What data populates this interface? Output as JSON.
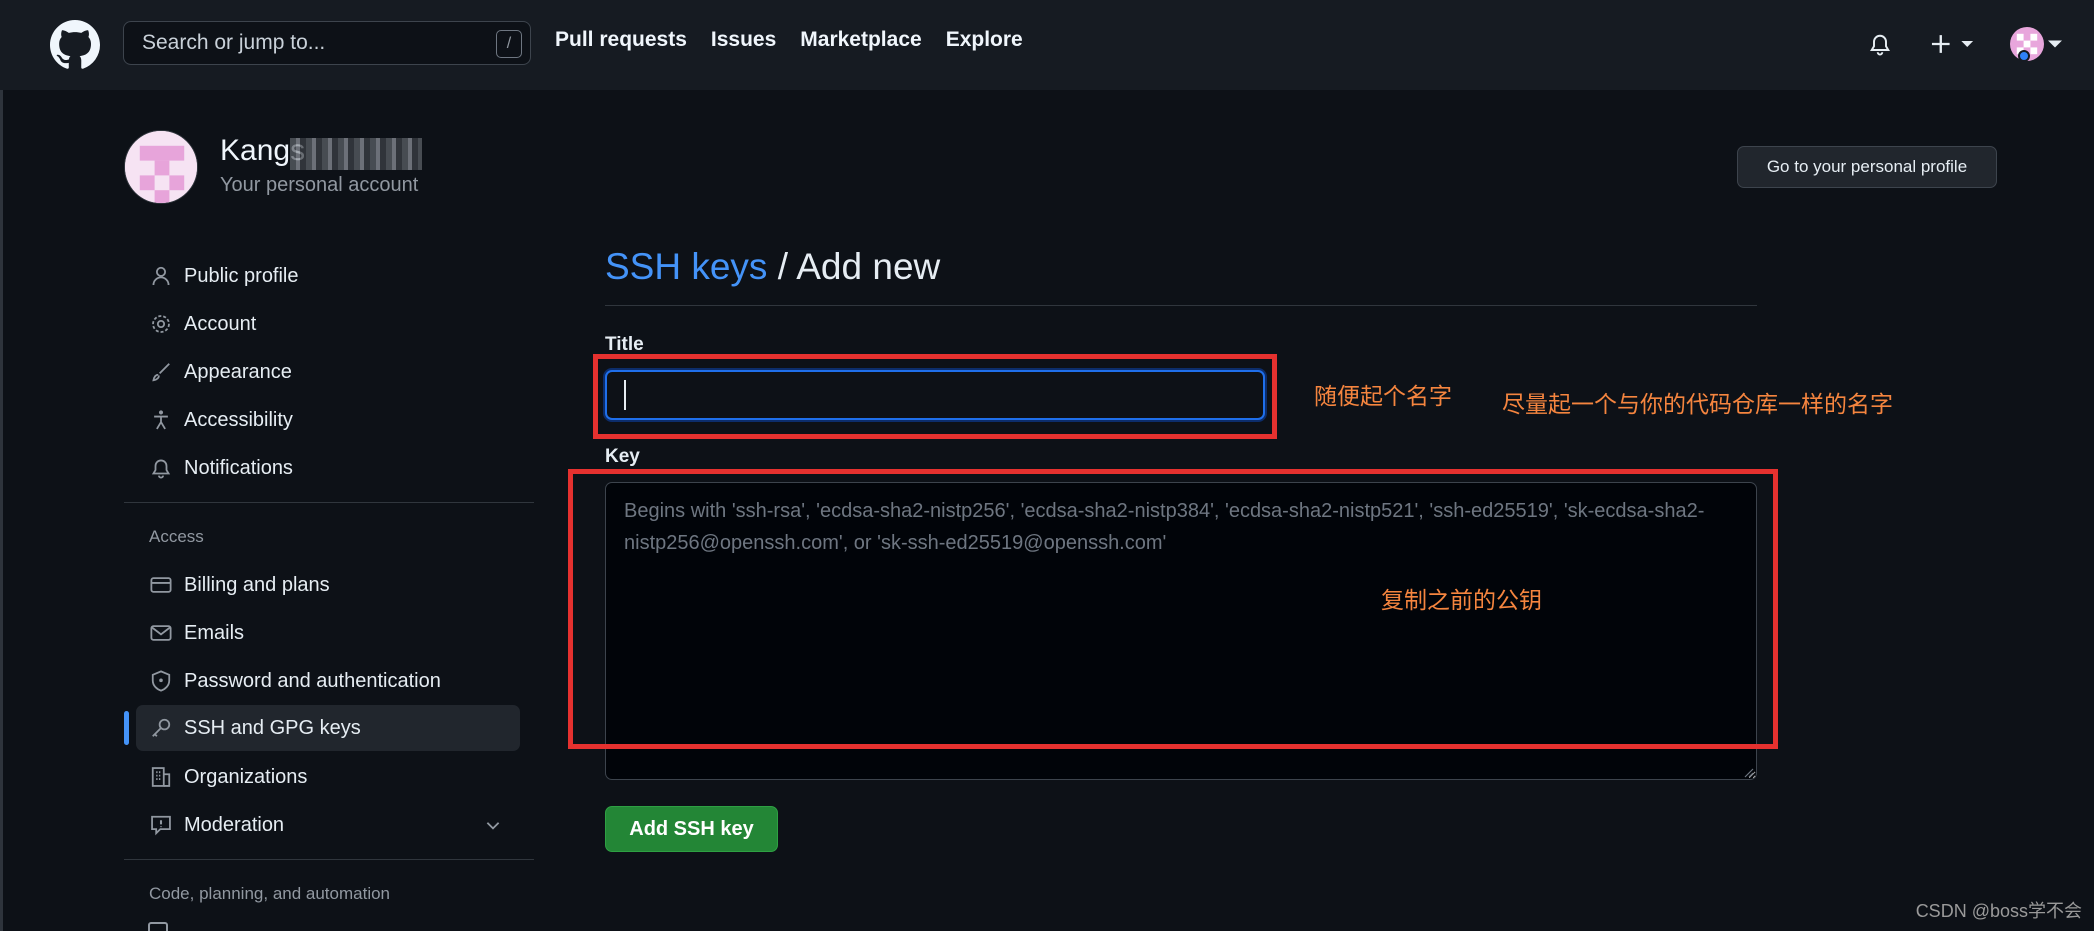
{
  "header": {
    "search_placeholder": "Search or jump to...",
    "search_shortcut": "/",
    "nav": [
      "Pull requests",
      "Issues",
      "Marketplace",
      "Explore"
    ],
    "icons": [
      "bell-icon",
      "plus-icon",
      "avatar"
    ]
  },
  "profile": {
    "name": "Kangs",
    "subtitle": "Your personal account",
    "go_profile_label": "Go to your personal profile"
  },
  "sidebar": {
    "items": [
      {
        "label": "Public profile",
        "icon": "person-icon"
      },
      {
        "label": "Account",
        "icon": "gear-icon"
      },
      {
        "label": "Appearance",
        "icon": "paintbrush-icon"
      },
      {
        "label": "Accessibility",
        "icon": "accessibility-icon"
      },
      {
        "label": "Notifications",
        "icon": "bell-icon"
      }
    ],
    "access_heading": "Access",
    "access_items": [
      {
        "label": "Billing and plans",
        "icon": "credit-card-icon"
      },
      {
        "label": "Emails",
        "icon": "mail-icon"
      },
      {
        "label": "Password and authentication",
        "icon": "shield-lock-icon"
      },
      {
        "label": "SSH and GPG keys",
        "icon": "key-icon",
        "active": true
      },
      {
        "label": "Organizations",
        "icon": "organization-icon"
      },
      {
        "label": "Moderation",
        "icon": "report-icon"
      }
    ],
    "code_heading": "Code, planning, and automation"
  },
  "main": {
    "breadcrumb": "SSH keys",
    "title_separator": " / ",
    "title": "Add new",
    "title_label": "Title",
    "title_value": "",
    "key_label": "Key",
    "key_placeholder": "Begins with 'ssh-rsa', 'ecdsa-sha2-nistp256', 'ecdsa-sha2-nistp384', 'ecdsa-sha2-nistp521', 'ssh-ed25519', 'sk-ecdsa-sha2-nistp256@openssh.com', or 'sk-ssh-ed25519@openssh.com'",
    "submit_label": "Add SSH key"
  },
  "annotations": {
    "note_title": "随便起个名字",
    "note_title2": "尽量起一个与你的代码仓库一样的名字",
    "note_key": "复制之前的公钥",
    "color": "#e5312f"
  },
  "watermark": "CSDN @boss学不会",
  "colors": {
    "accent": "#4493f8",
    "button": "#238636",
    "background": "#0d1117",
    "header": "#161b22"
  }
}
